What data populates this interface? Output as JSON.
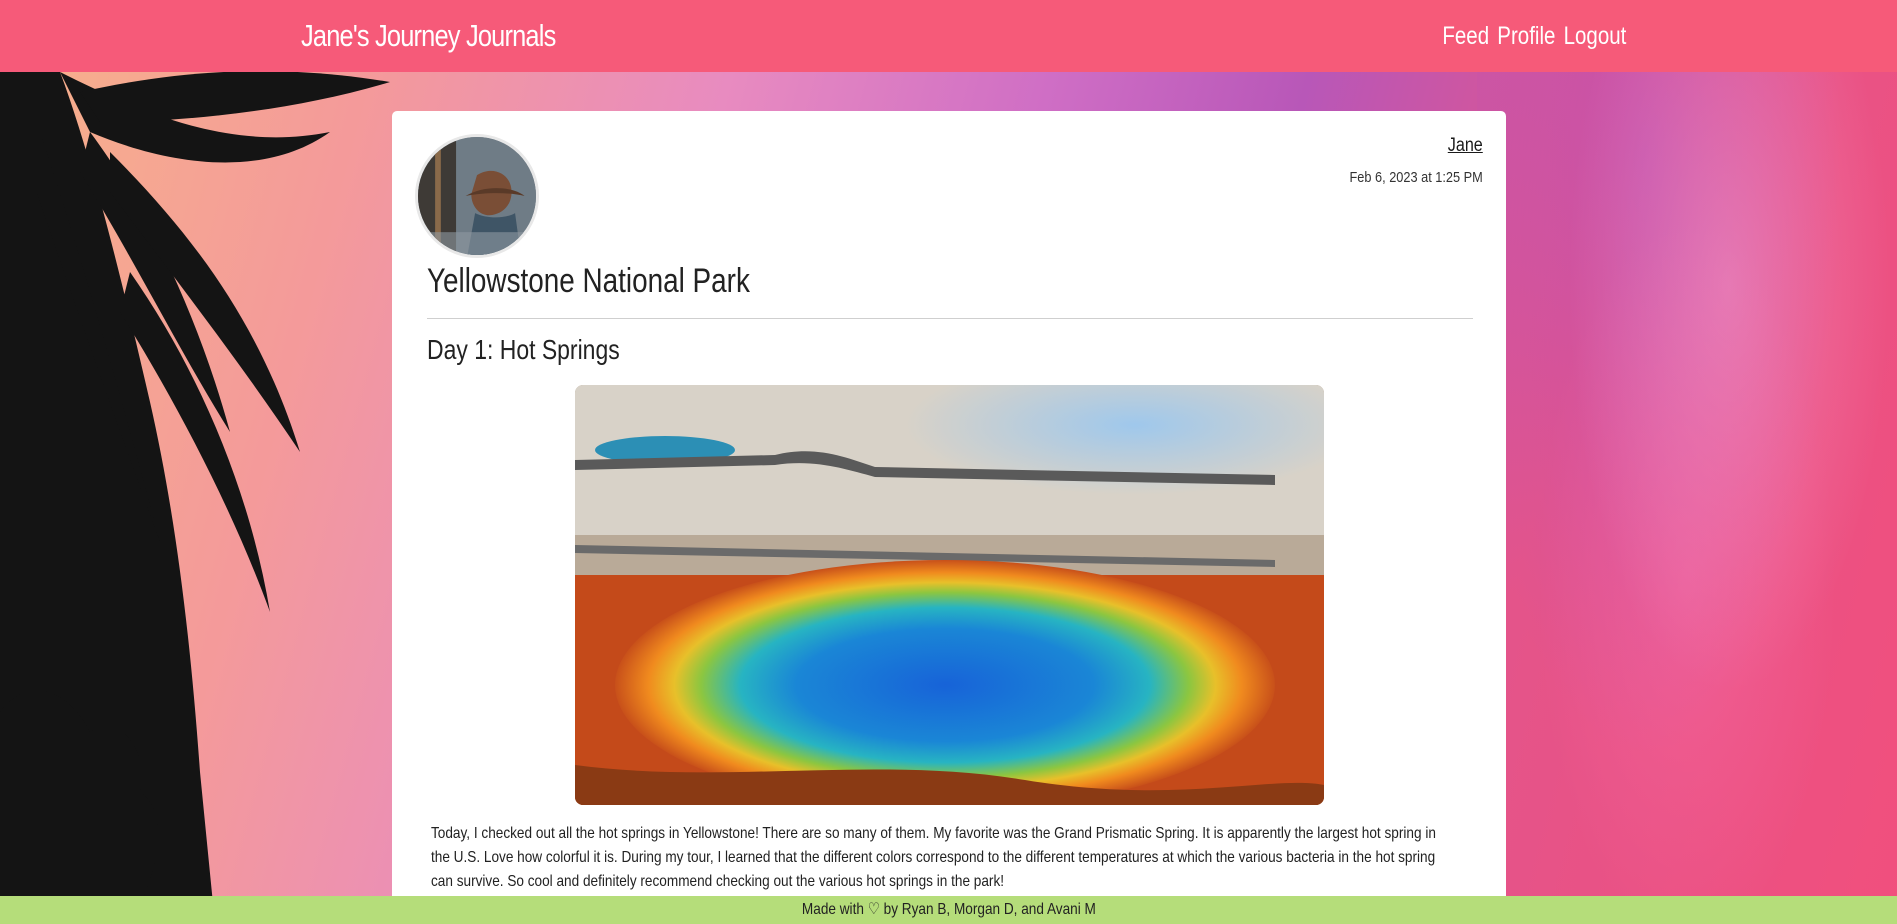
{
  "navbar": {
    "brand": "Jane's Journey Journals",
    "links": [
      "Feed",
      "Profile",
      "Logout"
    ]
  },
  "post": {
    "author": "Jane",
    "date": "Feb 6, 2023 at 1:25 PM",
    "title": "Yellowstone National Park",
    "entry_title": "Day 1: Hot Springs",
    "body": "Today, I checked out all the hot springs in Yellowstone! There are so many of them. My favorite was the Grand Prismatic Spring. It is apparently the largest hot spring in the U.S. Love how colorful it is. During my tour, I learned that the different colors correspond to the different temperatures at which the various bacteria in the hot spring can survive. So cool and definitely recommend checking out the various hot springs in the park!"
  },
  "footer": {
    "text": "Made with ♡ by Ryan B, Morgan D, and Avani M"
  },
  "colors": {
    "navbar": "#f65a79",
    "footer": "#b5dd7a",
    "card": "#ffffff"
  }
}
